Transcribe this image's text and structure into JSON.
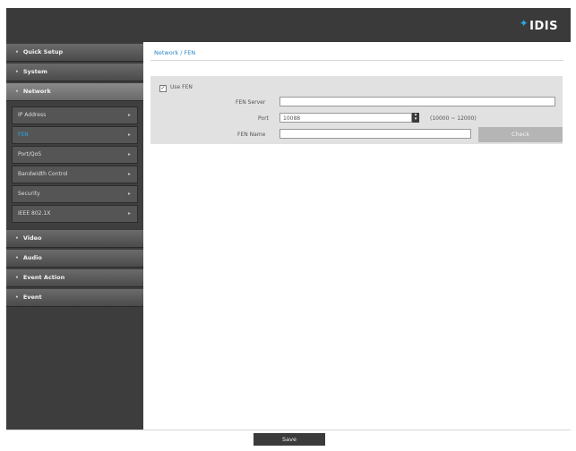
{
  "brand": {
    "logo_text": "IDIS",
    "accent_color": "#2aa7e0"
  },
  "sidebar": {
    "top_items": [
      {
        "label": "Quick Setup"
      },
      {
        "label": "System"
      },
      {
        "label": "Network"
      }
    ],
    "network_subitems": [
      {
        "label": "IP Address"
      },
      {
        "label": "FEN"
      },
      {
        "label": "Port/QoS"
      },
      {
        "label": "Bandwidth Control"
      },
      {
        "label": "Security"
      },
      {
        "label": "IEEE 802.1X"
      }
    ],
    "bottom_items": [
      {
        "label": "Video"
      },
      {
        "label": "Audio"
      },
      {
        "label": "Event Action"
      },
      {
        "label": "Event"
      }
    ]
  },
  "main": {
    "breadcrumb": "Network / FEN",
    "use_fen_label": "Use FEN",
    "use_fen_checked": true,
    "fen_server_label": "FEN Server",
    "fen_server_value": "",
    "port_label": "Port",
    "port_value": "10088",
    "port_range": "(10000 ~ 12000)",
    "fen_name_label": "FEN Name",
    "fen_name_value": "",
    "check_button": "Check"
  },
  "footer": {
    "save_button": "Save"
  }
}
